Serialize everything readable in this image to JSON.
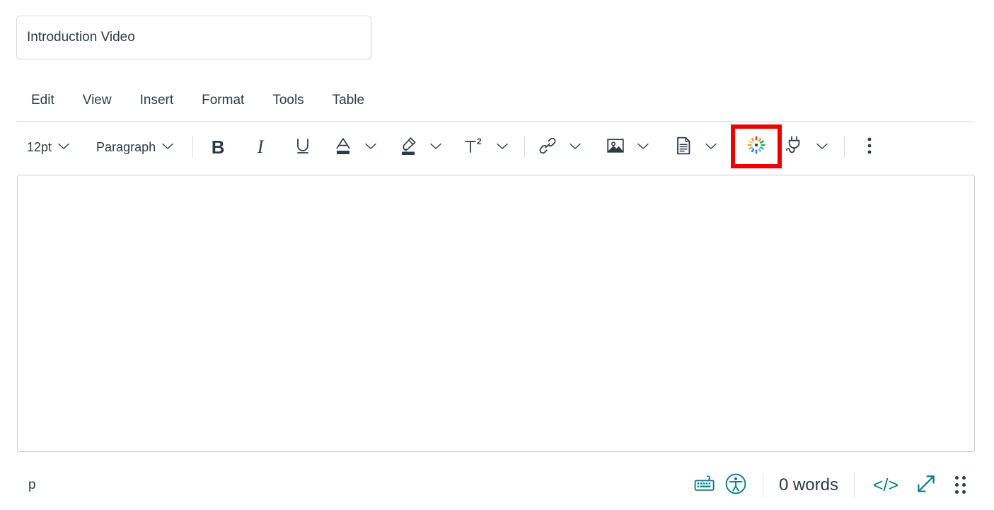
{
  "title_field": {
    "name": "assignment-title",
    "value": "Introduction Video",
    "placeholder": "Title"
  },
  "menubar": {
    "items": [
      {
        "label": "Edit",
        "name": "menu-edit"
      },
      {
        "label": "View",
        "name": "menu-view"
      },
      {
        "label": "Insert",
        "name": "menu-insert"
      },
      {
        "label": "Format",
        "name": "menu-format"
      },
      {
        "label": "Tools",
        "name": "menu-tools"
      },
      {
        "label": "Table",
        "name": "menu-table"
      }
    ]
  },
  "toolbar": {
    "font_size": "12pt",
    "block_format": "Paragraph",
    "bold_label": "B",
    "italic_label": "I",
    "icons": {
      "underline": "underline-icon",
      "text_color": "text-color-icon",
      "highlight": "highlight-color-icon",
      "superscript": "superscript-icon",
      "link": "link-icon",
      "image": "image-icon",
      "document": "document-icon",
      "studio": "canvas-studio-icon",
      "apps": "plug-apps-icon",
      "more": "kebab-more-options-icon"
    },
    "colors": {
      "text_color_swatch": "#2D3B45",
      "highlight_swatch": "#2D3B45",
      "icon": "#2D3B45",
      "separator": "#D7DADE",
      "studio_red": "#E8373D",
      "studio_orange": "#F5A623",
      "studio_yellow": "#F8D64E",
      "studio_green": "#2FA84F",
      "studio_teal": "#3AAFA9",
      "studio_blue": "#3C7DD6",
      "studio_light_blue": "#76C5E8",
      "studio_pink": "#F08C9E"
    }
  },
  "highlight_annotation": {
    "name": "studio-button-highlight",
    "color": "#EE0000",
    "target": "canvas-studio-icon"
  },
  "editor": {
    "name": "rich-text-body",
    "content": "",
    "border_color": "#C7CDD1"
  },
  "statusbar": {
    "element_path": "p",
    "word_count": "0 words",
    "accent_color": "#0B7C8A",
    "icons": {
      "keyboard_shortcuts": "keyboard-icon",
      "accessibility_checker": "accessibility-icon",
      "html_editor": "html-editor-icon",
      "fullscreen": "fullscreen-expand-icon",
      "resize": "resize-handle-icon"
    },
    "html_editor_label": "</>"
  }
}
